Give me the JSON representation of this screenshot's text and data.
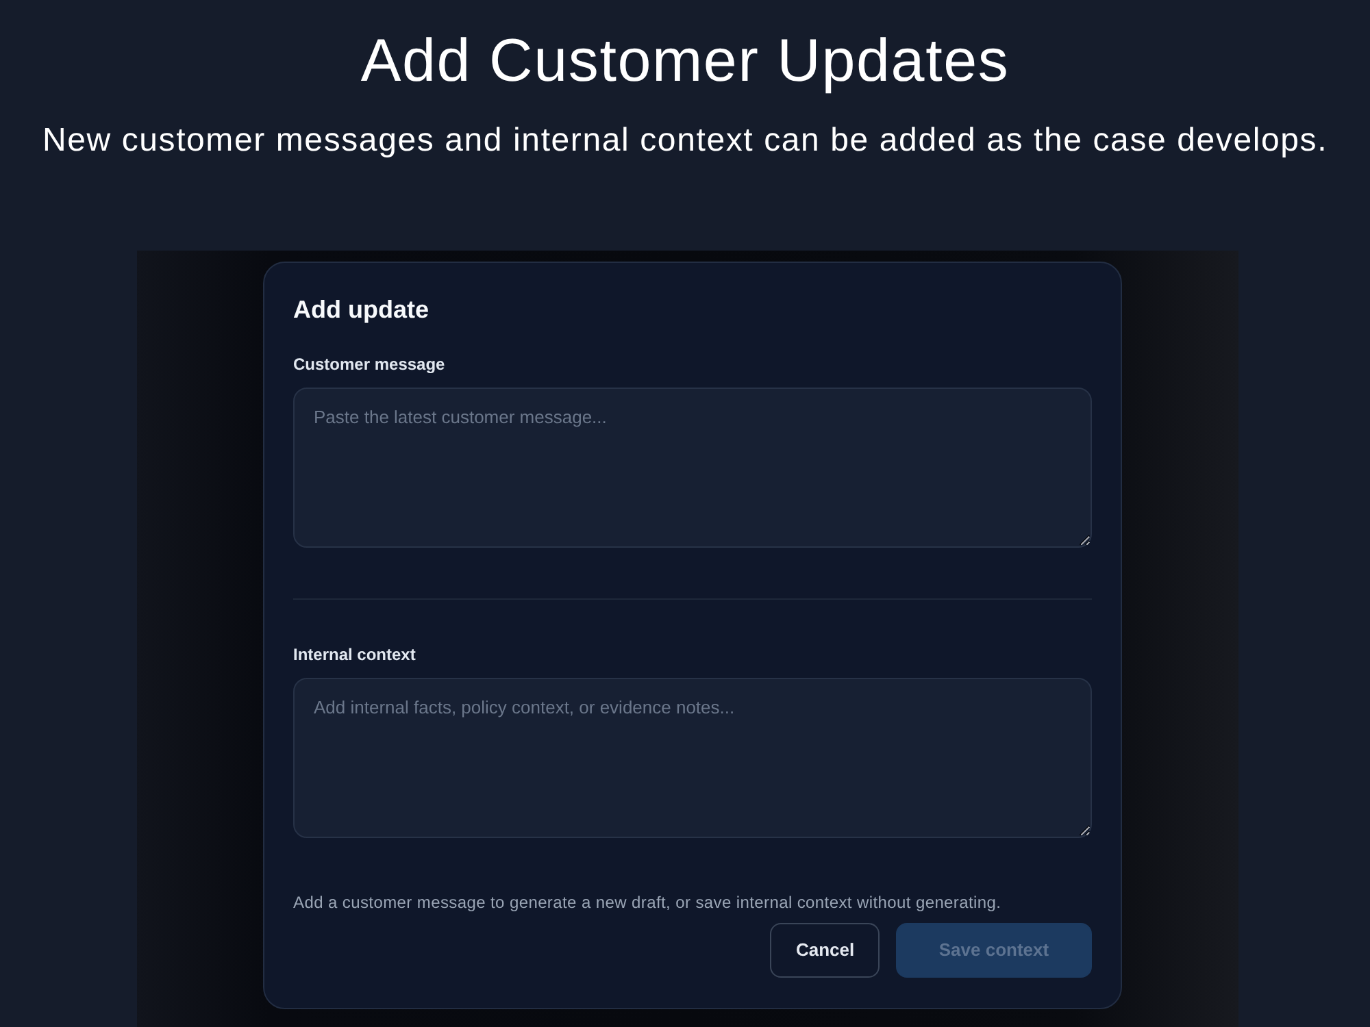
{
  "hero": {
    "title": "Add Customer Updates",
    "subtitle": "New customer messages and internal context can be added as the case develops."
  },
  "dialog": {
    "title": "Add update",
    "fields": [
      {
        "label": "Customer message",
        "placeholder": "Paste the latest customer message..."
      },
      {
        "label": "Internal context",
        "placeholder": "Add internal facts, policy context, or evidence notes..."
      }
    ],
    "hint": "Add a customer message to generate a new draft, or save internal context without generating.",
    "buttons": [
      {
        "label": "Cancel",
        "kind": "secondary",
        "disabled": false
      },
      {
        "label": "Save context",
        "kind": "primary",
        "disabled": true
      }
    ]
  }
}
